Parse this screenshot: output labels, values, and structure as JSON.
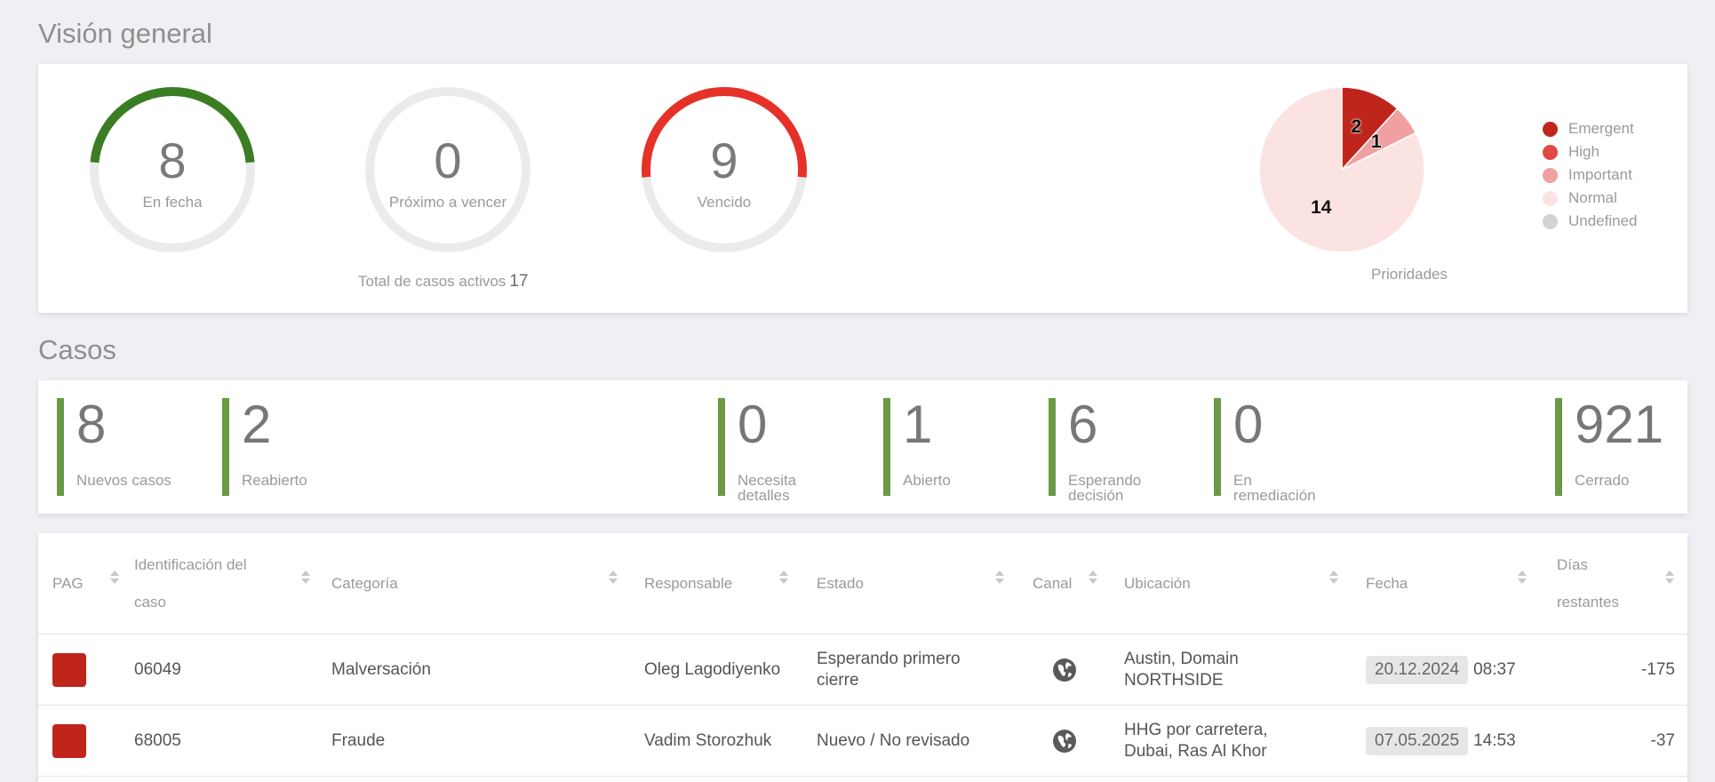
{
  "overview": {
    "title": "Visión general",
    "gauges": [
      {
        "value": "8",
        "label": "En fecha",
        "color": "#3a7d22",
        "fraction": 0.47
      },
      {
        "value": "0",
        "label": "Próximo a vencer",
        "color": "#e8e8e8",
        "fraction": 0
      },
      {
        "value": "9",
        "label": "Vencido",
        "color": "#e53127",
        "fraction": 0.53
      }
    ],
    "total_label": "Total de casos activos",
    "total_value": "17",
    "priorities": {
      "caption": "Prioridades",
      "legend": [
        {
          "name": "Emergent",
          "color": "#c0251c"
        },
        {
          "name": "High",
          "color": "#e04a44"
        },
        {
          "name": "Important",
          "color": "#f0a0a0"
        },
        {
          "name": "Normal",
          "color": "#fbe3e2"
        },
        {
          "name": "Undefined",
          "color": "#d3d3d3"
        }
      ]
    }
  },
  "chart_data": {
    "type": "pie",
    "title": "Prioridades",
    "categories": [
      "Emergent",
      "High",
      "Important",
      "Normal",
      "Undefined"
    ],
    "values": [
      2,
      0,
      1,
      14,
      0
    ],
    "colors": [
      "#c0251c",
      "#e04a44",
      "#f0a0a0",
      "#fbe3e2",
      "#d3d3d3"
    ],
    "legend": "right"
  },
  "cases": {
    "title": "Casos",
    "counters": [
      {
        "value": "8",
        "label": "Nuevos casos"
      },
      {
        "value": "2",
        "label": "Reabierto"
      },
      {
        "value": "0",
        "label": "Necesita detalles"
      },
      {
        "value": "1",
        "label": "Abierto"
      },
      {
        "value": "6",
        "label": "Esperando decisión"
      },
      {
        "value": "0",
        "label": "En remediación"
      },
      {
        "value": "921",
        "label": "Cerrado"
      }
    ]
  },
  "table": {
    "columns": [
      "PAG",
      "Identificación del caso",
      "Categoría",
      "Responsable",
      "Estado",
      "Canal",
      "Ubicación",
      "Fecha",
      "Días restantes"
    ],
    "rows": [
      {
        "pag_color": "#c0251c",
        "id": "06049",
        "category": "Malversación",
        "owner": "Oleg Lagodiyenko",
        "status": "Esperando primero cierre",
        "channel_icon": "globe-icon",
        "location": "Austin, Domain NORTHSIDE",
        "date": "20.12.2024",
        "time": "08:37",
        "days": "-175"
      },
      {
        "pag_color": "#c0251c",
        "id": "68005",
        "category": "Fraude",
        "owner": "Vadim Storozhuk",
        "status": "Nuevo / No revisado",
        "channel_icon": "globe-icon",
        "location": "HHG por carretera, Dubai, Ras Al Khor",
        "date": "07.05.2025",
        "time": "14:53",
        "days": "-37"
      }
    ]
  }
}
